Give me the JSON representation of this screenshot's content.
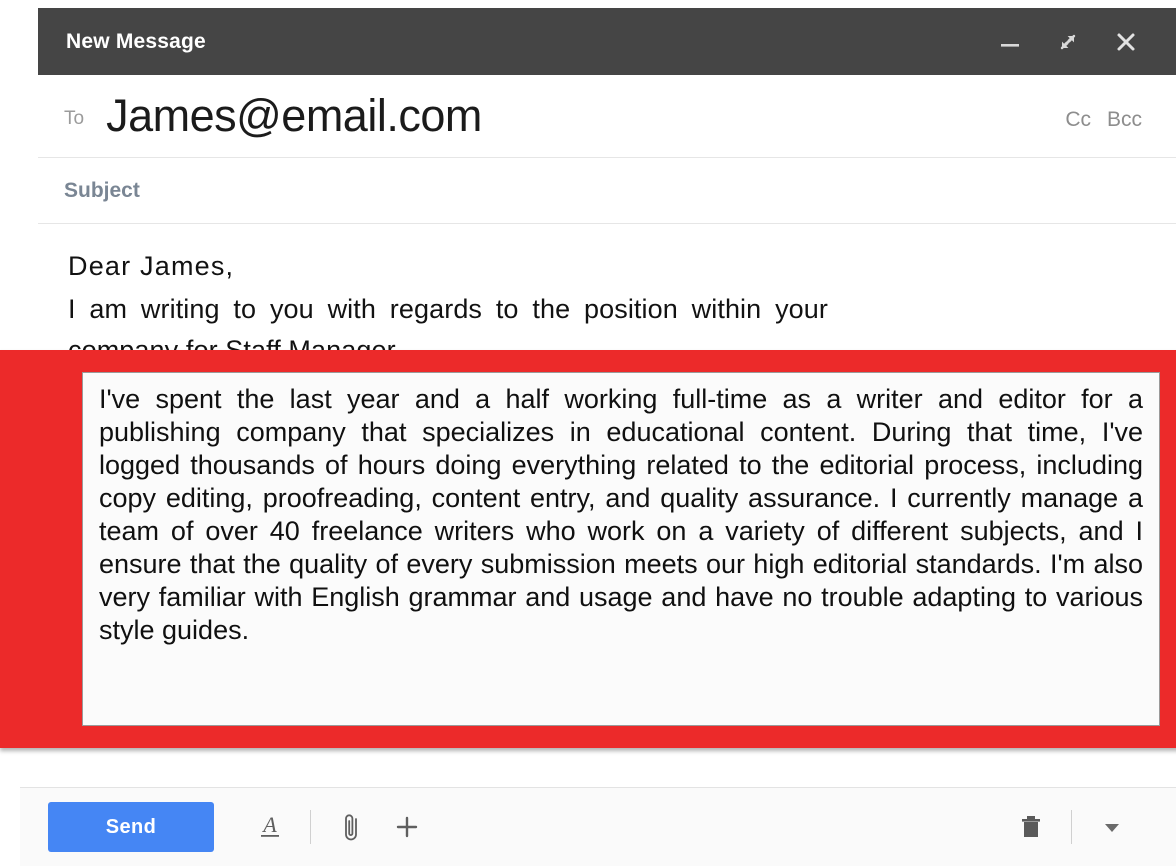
{
  "window": {
    "title": "New Message",
    "controls": [
      {
        "name": "minimize",
        "icon": "minimize-icon"
      },
      {
        "name": "expand",
        "icon": "expand-icon"
      },
      {
        "name": "close",
        "icon": "close-icon"
      }
    ]
  },
  "fields": {
    "to_label": "To",
    "to_value": "James@email.com",
    "cc_label": "Cc",
    "bcc_label": "Bcc",
    "subject_label": "Subject",
    "subject_value": ""
  },
  "body": {
    "salutation": "Dear  James,",
    "intro": "I am writing to you with regards to the position within your company for Staff Manager",
    "highlighted_paragraph": "I've spent the last year and a half working full-time as a writer and editor for a publishing company that specializes in educational content. During that time, I've logged thousands of hours doing everything related to the editorial process, including copy editing, proofreading, content entry, and quality assurance. I currently manage a team of over 40 freelance writers who work on a variety of different subjects, and I ensure that the quality of every submission meets our high editorial standards. I'm also very familiar with English grammar and usage and have no trouble adapting to various style guides."
  },
  "toolbar": {
    "send_label": "Send",
    "format_icon": "format-text-icon",
    "attach_icon": "paperclip-icon",
    "insert_icon": "plus-icon",
    "discard_icon": "trash-icon",
    "more_icon": "chevron-down-icon"
  },
  "colors": {
    "header_bg": "#454545",
    "send_blue": "#4586f4",
    "highlight_red": "#ec2a2a",
    "label_gray": "#9b9b9b",
    "subject_label": "#7a8694",
    "body_text": "#121212"
  }
}
